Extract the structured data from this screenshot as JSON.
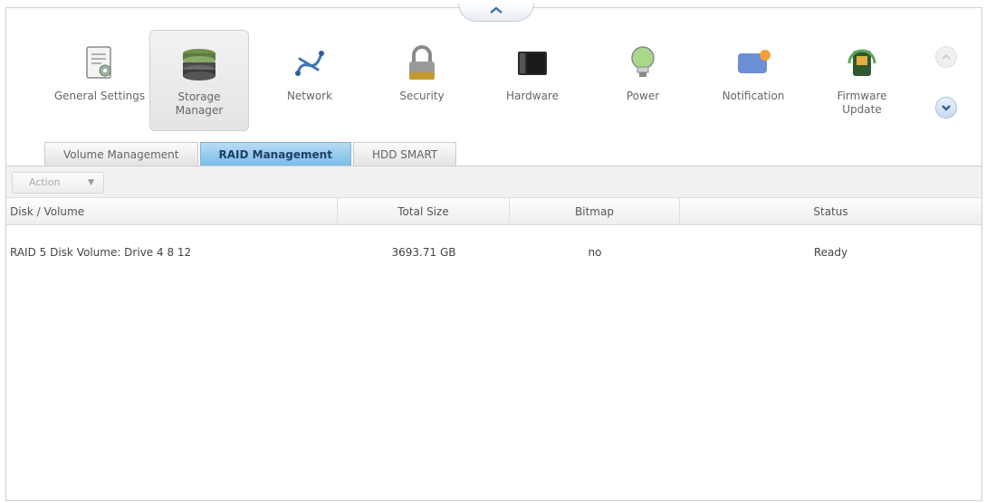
{
  "toolbar": {
    "items": [
      {
        "label": "General Settings",
        "icon": "general-settings-icon"
      },
      {
        "label": "Storage Manager",
        "icon": "storage-manager-icon",
        "active": true
      },
      {
        "label": "Network",
        "icon": "network-icon"
      },
      {
        "label": "Security",
        "icon": "security-icon"
      },
      {
        "label": "Hardware",
        "icon": "hardware-icon"
      },
      {
        "label": "Power",
        "icon": "power-icon"
      },
      {
        "label": "Notification",
        "icon": "notification-icon"
      },
      {
        "label": "Firmware Update",
        "icon": "firmware-update-icon"
      }
    ]
  },
  "tabs": [
    {
      "label": "Volume Management",
      "active": false
    },
    {
      "label": "RAID Management",
      "active": true
    },
    {
      "label": "HDD SMART",
      "active": false
    }
  ],
  "action": {
    "label": "Action"
  },
  "table": {
    "columns": [
      "Disk / Volume",
      "Total Size",
      "Bitmap",
      "Status"
    ],
    "rows": [
      {
        "disk": "RAID 5 Disk Volume: Drive 4 8 12",
        "size": "3693.71 GB",
        "bitmap": "no",
        "status": "Ready"
      }
    ]
  },
  "colors": {
    "active_tab": "#79bde8",
    "accent": "#2a7fc0"
  }
}
